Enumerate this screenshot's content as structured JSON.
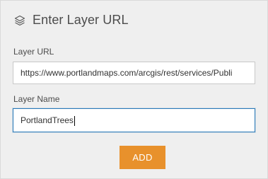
{
  "header": {
    "title": "Enter Layer URL",
    "icon": "layers-icon"
  },
  "form": {
    "url_label": "Layer URL",
    "url_value": "https://www.portlandmaps.com/arcgis/rest/services/Publi",
    "name_label": "Layer Name",
    "name_value": "PortlandTrees"
  },
  "actions": {
    "add_label": "ADD"
  },
  "colors": {
    "panel_bg": "#efefef",
    "accent_button": "#e8912c",
    "focus_border": "#2b7ab8",
    "text": "#4c4c4c"
  }
}
